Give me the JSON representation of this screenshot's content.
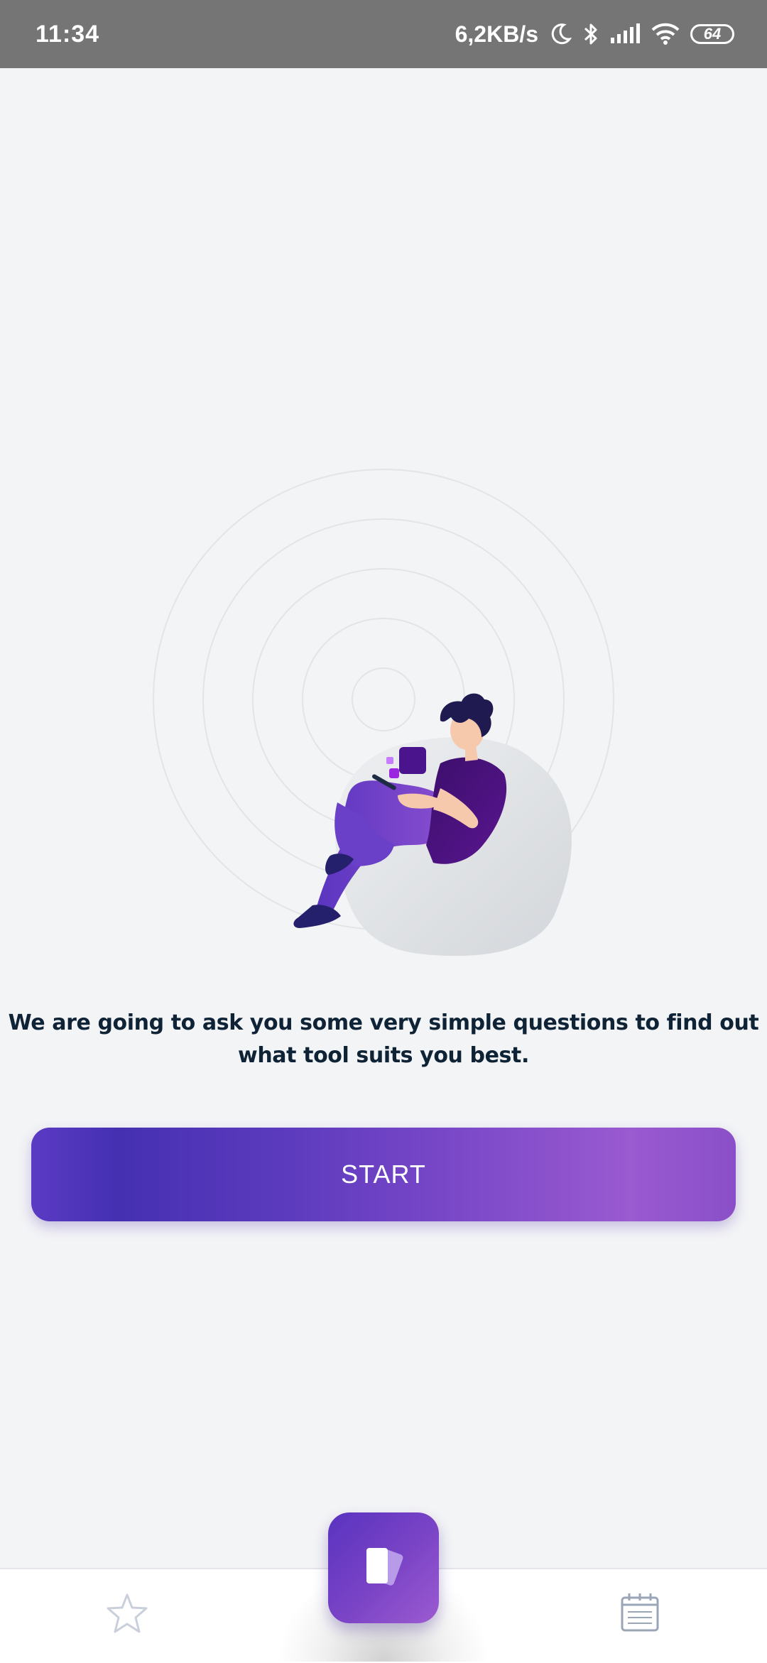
{
  "status_bar": {
    "time": "11:34",
    "network_speed": "6,2KB/s",
    "battery_level": "64",
    "icons": [
      "moon-icon",
      "bluetooth-icon",
      "signal-icon",
      "wifi-icon",
      "battery-icon"
    ]
  },
  "main": {
    "message": "We are going to ask you some very simple questions to find out what tool suits you best.",
    "start_label": "START"
  },
  "bottom_nav": {
    "items": [
      "star-icon",
      "cards-icon",
      "calendar-icon"
    ]
  },
  "colors": {
    "background": "#f3f4f6",
    "status_bar": "#757575",
    "accent_start": "#4530b2",
    "accent_end": "#9a5ad0",
    "text_dark": "#0f2336"
  }
}
